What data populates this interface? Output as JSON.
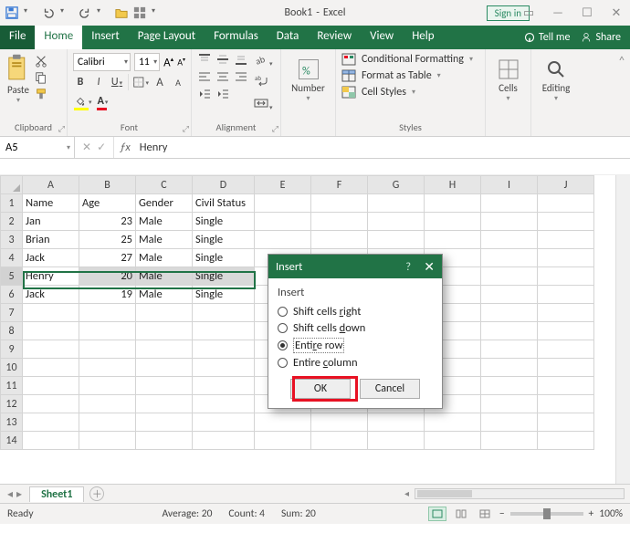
{
  "title": {
    "doc": "Book1",
    "app": "Excel"
  },
  "signin": "Sign in",
  "auto_save": {
    "label": "",
    "state": "off"
  },
  "tabs": [
    "File",
    "Home",
    "Insert",
    "Page Layout",
    "Formulas",
    "Data",
    "Review",
    "View",
    "Help"
  ],
  "active_tab": "Home",
  "tellme": "Tell me",
  "share": "Share",
  "ribbon": {
    "clipboard": {
      "label": "Clipboard",
      "paste": "Paste"
    },
    "font": {
      "label": "Font",
      "name": "Calibri",
      "size": "11",
      "bold": "B",
      "italic": "I",
      "underline": "U"
    },
    "alignment": {
      "label": "Alignment"
    },
    "number": {
      "label": "Number",
      "btn": "Number"
    },
    "styles": {
      "label": "Styles",
      "cond": "Conditional Formatting",
      "table": "Format as Table",
      "cell": "Cell Styles"
    },
    "cells": {
      "label": "Cells",
      "btn": "Cells"
    },
    "editing": {
      "label": "Editing",
      "btn": "Editing"
    }
  },
  "namebox": "A5",
  "formula": "Henry",
  "columns": [
    "A",
    "B",
    "C",
    "D",
    "E",
    "F",
    "G",
    "H",
    "I",
    "J"
  ],
  "table": {
    "headers": [
      "Name",
      "Age",
      "Gender",
      "Civil Status"
    ],
    "rows": [
      {
        "r": 2,
        "name": "Jan",
        "age": 23,
        "gender": "Male",
        "status": "Single"
      },
      {
        "r": 3,
        "name": "Brian",
        "age": 25,
        "gender": "Male",
        "status": "Single"
      },
      {
        "r": 4,
        "name": "Jack",
        "age": 27,
        "gender": "Male",
        "status": "Single"
      },
      {
        "r": 5,
        "name": "Henry",
        "age": 20,
        "gender": "Male",
        "status": "Single"
      },
      {
        "r": 6,
        "name": "Jack",
        "age": 19,
        "gender": "Male",
        "status": "Single"
      }
    ],
    "selected_row": 5,
    "active_cell": "A5"
  },
  "sheet_tab": "Sheet1",
  "status": {
    "state": "Ready",
    "average_label": "Average:",
    "average": "20",
    "count_label": "Count:",
    "count": "4",
    "sum_label": "Sum:",
    "sum": "20",
    "zoom": "100%"
  },
  "dialog": {
    "title": "Insert",
    "group": "Insert",
    "options": {
      "right": {
        "pre": "Shift cells ",
        "u": "r",
        "post": "ight"
      },
      "down": {
        "pre": "Shift cells ",
        "u": "d",
        "post": "own"
      },
      "row": {
        "pre": "Enti",
        "u": "r",
        "post": "e row"
      },
      "column": {
        "pre": "Entire ",
        "u": "c",
        "post": "olumn"
      }
    },
    "selected": "row",
    "ok": "OK",
    "cancel": "Cancel"
  }
}
